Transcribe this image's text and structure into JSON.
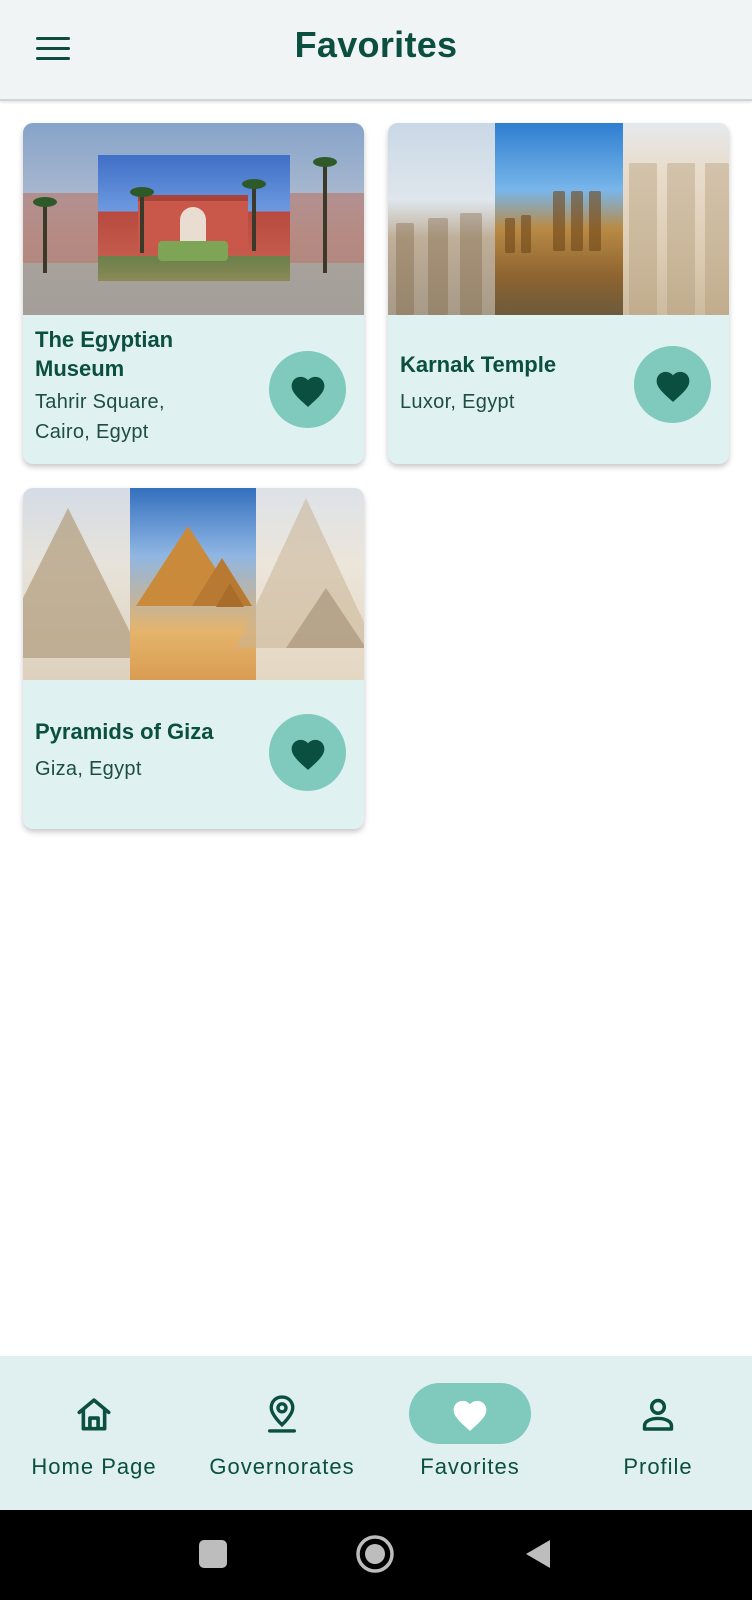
{
  "app_bar": {
    "title": "Favorites",
    "menu_icon": "hamburger-menu-icon"
  },
  "favorites": [
    {
      "name": "The Egyptian Museum",
      "location": "Tahrir Square, Cairo, Egypt",
      "favorited": true
    },
    {
      "name": "Karnak Temple",
      "location": "Luxor, Egypt",
      "favorited": true
    },
    {
      "name": "Pyramids of Giza",
      "location": "Giza, Egypt",
      "favorited": true
    }
  ],
  "bottom_nav": {
    "items": [
      {
        "label": "Home Page",
        "icon": "home-icon",
        "active": false
      },
      {
        "label": "Governorates",
        "icon": "location-pin-icon",
        "active": false
      },
      {
        "label": "Favorites",
        "icon": "heart-icon",
        "active": true
      },
      {
        "label": "Profile",
        "icon": "person-icon",
        "active": false
      }
    ]
  },
  "colors": {
    "primary": "#0a4f40",
    "card_background": "#e0f1f1",
    "accent": "#7fc9bd",
    "app_bar": "#f1f4f4"
  }
}
